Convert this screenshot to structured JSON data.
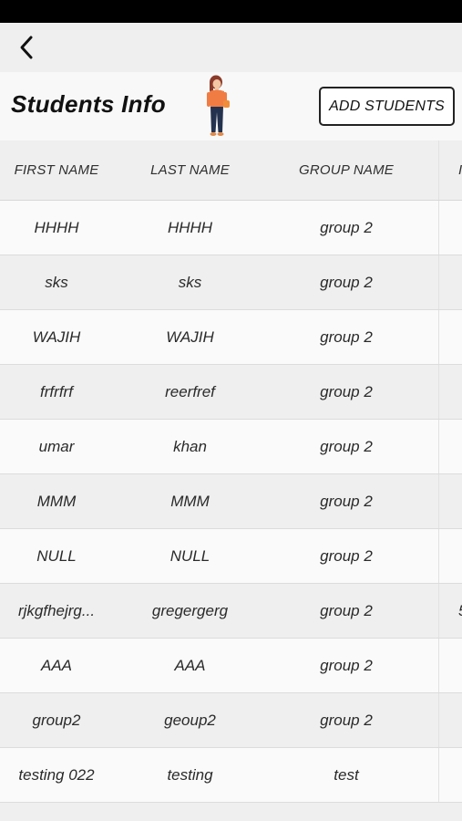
{
  "header": {
    "title": "Students Info",
    "add_button_label": "ADD STUDENTS"
  },
  "illustration": {
    "colors": {
      "hair": "#8a3b2a",
      "top": "#f07c43",
      "pants": "#24324f",
      "skin": "#f3c6a4",
      "bag": "#ef8d3a"
    }
  },
  "table": {
    "columns": [
      "FIRST NAME",
      "LAST NAME",
      "GROUP NAME",
      "I"
    ],
    "rows": [
      [
        "HHHH",
        "HHHH",
        "group 2",
        ""
      ],
      [
        "sks",
        "sks",
        "group 2",
        ""
      ],
      [
        "WAJIH",
        "WAJIH",
        "group 2",
        ""
      ],
      [
        "frfrfrf",
        "reerfref",
        "group 2",
        ""
      ],
      [
        "umar",
        "khan",
        "group 2",
        ""
      ],
      [
        "MMM",
        "MMM",
        "group 2",
        ""
      ],
      [
        "NULL",
        "NULL",
        "group 2",
        ""
      ],
      [
        "rjkgfhejrg...",
        "gregergerg",
        "group 2",
        "5"
      ],
      [
        "AAA",
        "AAA",
        "group 2",
        ""
      ],
      [
        "group2",
        "geoup2",
        "group 2",
        ""
      ],
      [
        "testing 022",
        "testing",
        "test",
        ""
      ]
    ]
  }
}
